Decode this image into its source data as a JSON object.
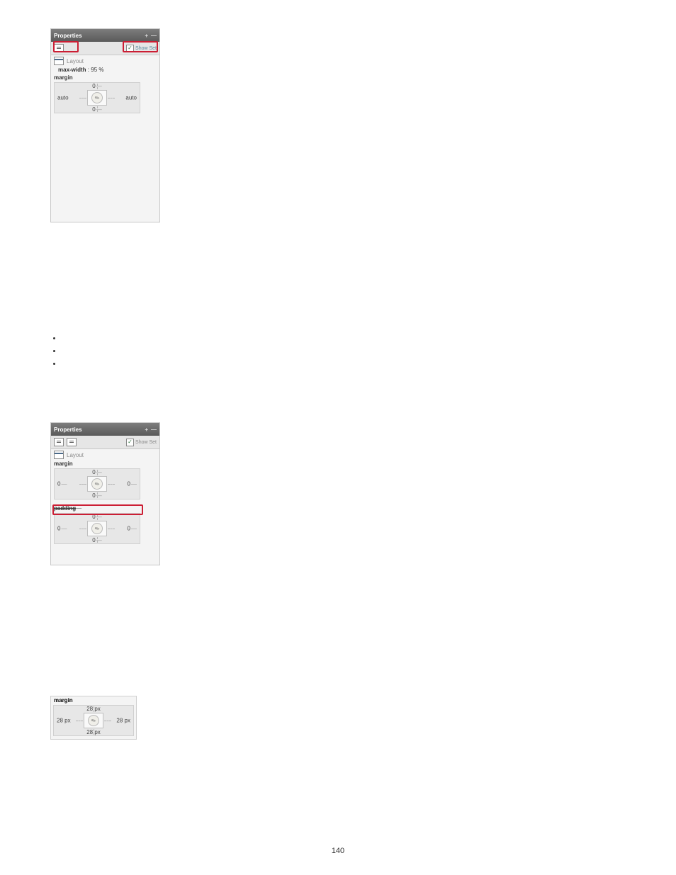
{
  "page_number": "140",
  "panel1": {
    "title": "Properties",
    "show_set": "Show Set",
    "layout_label": "Layout",
    "max_width_label": "max-width",
    "max_width_value": "95 %",
    "margin_label": "margin",
    "box": {
      "top": "0",
      "right": "auto",
      "bottom": "0",
      "left": "auto"
    }
  },
  "bullets": [
    "",
    "",
    ""
  ],
  "panel2": {
    "title": "Properties",
    "show_set": "Show Set",
    "layout_label": "Layout",
    "margin_label": "margin",
    "margin_box": {
      "top": "0",
      "right": "0",
      "bottom": "0",
      "left": "0"
    },
    "padding_label": "padding",
    "padding_box": {
      "top": "0",
      "right": "0",
      "bottom": "0",
      "left": "0"
    }
  },
  "panel3": {
    "margin_label": "margin",
    "box": {
      "top": "28 px",
      "right": "28 px",
      "bottom": "28 px",
      "left": "28 px"
    }
  }
}
